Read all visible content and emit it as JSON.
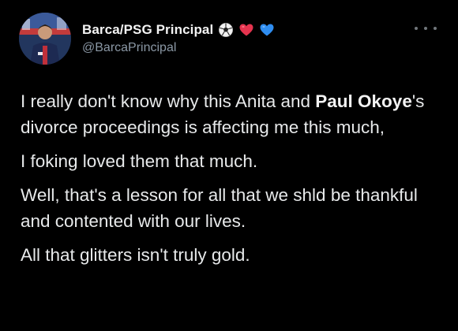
{
  "author": {
    "display_name": "Barca/PSG Principal",
    "handle": "@BarcaPrincipal",
    "emojis": [
      "soccer-ball",
      "red-heart",
      "blue-heart"
    ]
  },
  "tweet": {
    "p1_a": "I really don't know why this Anita and ",
    "p1_b": "Paul",
    "p1_c": " ",
    "p1_d": "Okoye",
    "p1_e": "'s divorce proceedings is affecting me this much,",
    "p2": "I foking loved them that much.",
    "p3": "Well, that's a lesson for all that we shld be thankful and contented with our lives.",
    "p4": "All that glitters isn't truly gold."
  },
  "colors": {
    "background": "#000000",
    "text": "#e7e9ea",
    "secondary": "#8b98a5"
  }
}
